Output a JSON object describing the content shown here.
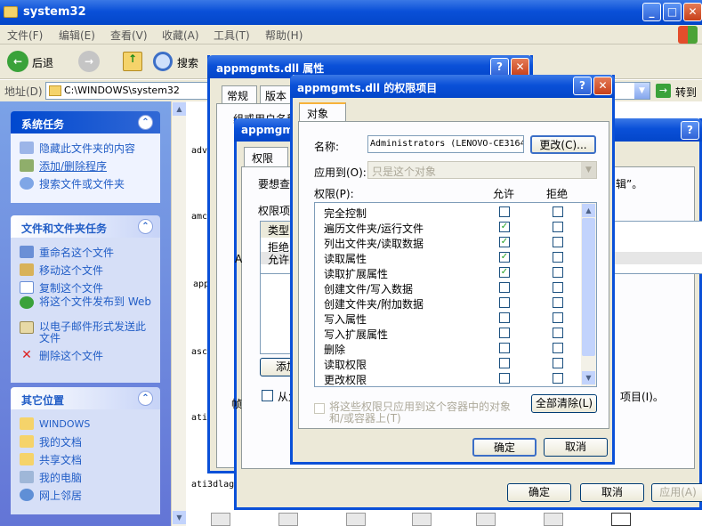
{
  "explorer": {
    "title": "system32",
    "menu": [
      "文件(F)",
      "编辑(E)",
      "查看(V)",
      "收藏(A)",
      "工具(T)",
      "帮助(H)"
    ],
    "toolbar": {
      "back": "后退",
      "search": "搜索"
    },
    "address_label": "地址(D)",
    "address_value": "C:\\WINDOWS\\system32",
    "go_label": "转到",
    "system_tasks": {
      "title": "系统任务",
      "items": [
        "隐藏此文件夹的内容",
        "添加/删除程序",
        "搜索文件或文件夹"
      ]
    },
    "file_tasks": {
      "title": "文件和文件夹任务",
      "items": [
        "重命名这个文件",
        "移动这个文件",
        "复制这个文件",
        "将这个文件发布到 Web",
        "以电子邮件形式发送此文件",
        "删除这个文件"
      ]
    },
    "other_places": {
      "title": "其它位置",
      "items": [
        "WINDOWS",
        "我的文档",
        "共享文档",
        "我的电脑",
        "网上邻居"
      ]
    },
    "file_labels": [
      "adva",
      "amcc",
      "app",
      "asc",
      "ati2",
      "ati3dlag."
    ]
  },
  "props": {
    "title": "appmgmts.dll 属性",
    "tabs": [
      "常规",
      "版本"
    ],
    "group_label": "组或用户名称",
    "ok": "确定",
    "cancel": "取消",
    "apply": "应用(A)",
    "tail_text": "项目(I)。"
  },
  "adv": {
    "title": "appmgmts.dll",
    "tab": "权限",
    "intro": "要想查看",
    "intro_tail": "辑”。",
    "list_label": "权限项",
    "col_type": "类型",
    "rows": [
      "拒绝",
      "允许"
    ],
    "add": "添加",
    "inherit": "从父",
    "a_letter": "A",
    "b_letter": "帧"
  },
  "perm": {
    "title": "appmgmts.dll 的权限项目",
    "tab": "对象",
    "name_label": "名称:",
    "name_value": "Administrators (LENOVO-CE3164",
    "change_btn": "更改(C)...",
    "apply_label": "应用到(O):",
    "apply_value": "只是这个对象",
    "perm_label": "权限(P):",
    "allow_label": "允许",
    "deny_label": "拒绝",
    "items": [
      {
        "name": "完全控制",
        "allow": false,
        "deny": false
      },
      {
        "name": "遍历文件夹/运行文件",
        "allow": true,
        "deny": false
      },
      {
        "name": "列出文件夹/读取数据",
        "allow": true,
        "deny": false
      },
      {
        "name": "读取属性",
        "allow": true,
        "deny": false
      },
      {
        "name": "读取扩展属性",
        "allow": true,
        "deny": false
      },
      {
        "name": "创建文件/写入数据",
        "allow": false,
        "deny": false
      },
      {
        "name": "创建文件夹/附加数据",
        "allow": false,
        "deny": false
      },
      {
        "name": "写入属性",
        "allow": false,
        "deny": false
      },
      {
        "name": "写入扩展属性",
        "allow": false,
        "deny": false
      },
      {
        "name": "删除",
        "allow": false,
        "deny": false
      },
      {
        "name": "读取权限",
        "allow": false,
        "deny": false
      },
      {
        "name": "更改权限",
        "allow": false,
        "deny": false
      }
    ],
    "inherit_text_1": "将这些权限只应用到这个容器中的对象",
    "inherit_text_2": "和/或容器上(T)",
    "clear_btn": "全部清除(L)",
    "ok": "确定",
    "cancel": "取消"
  }
}
